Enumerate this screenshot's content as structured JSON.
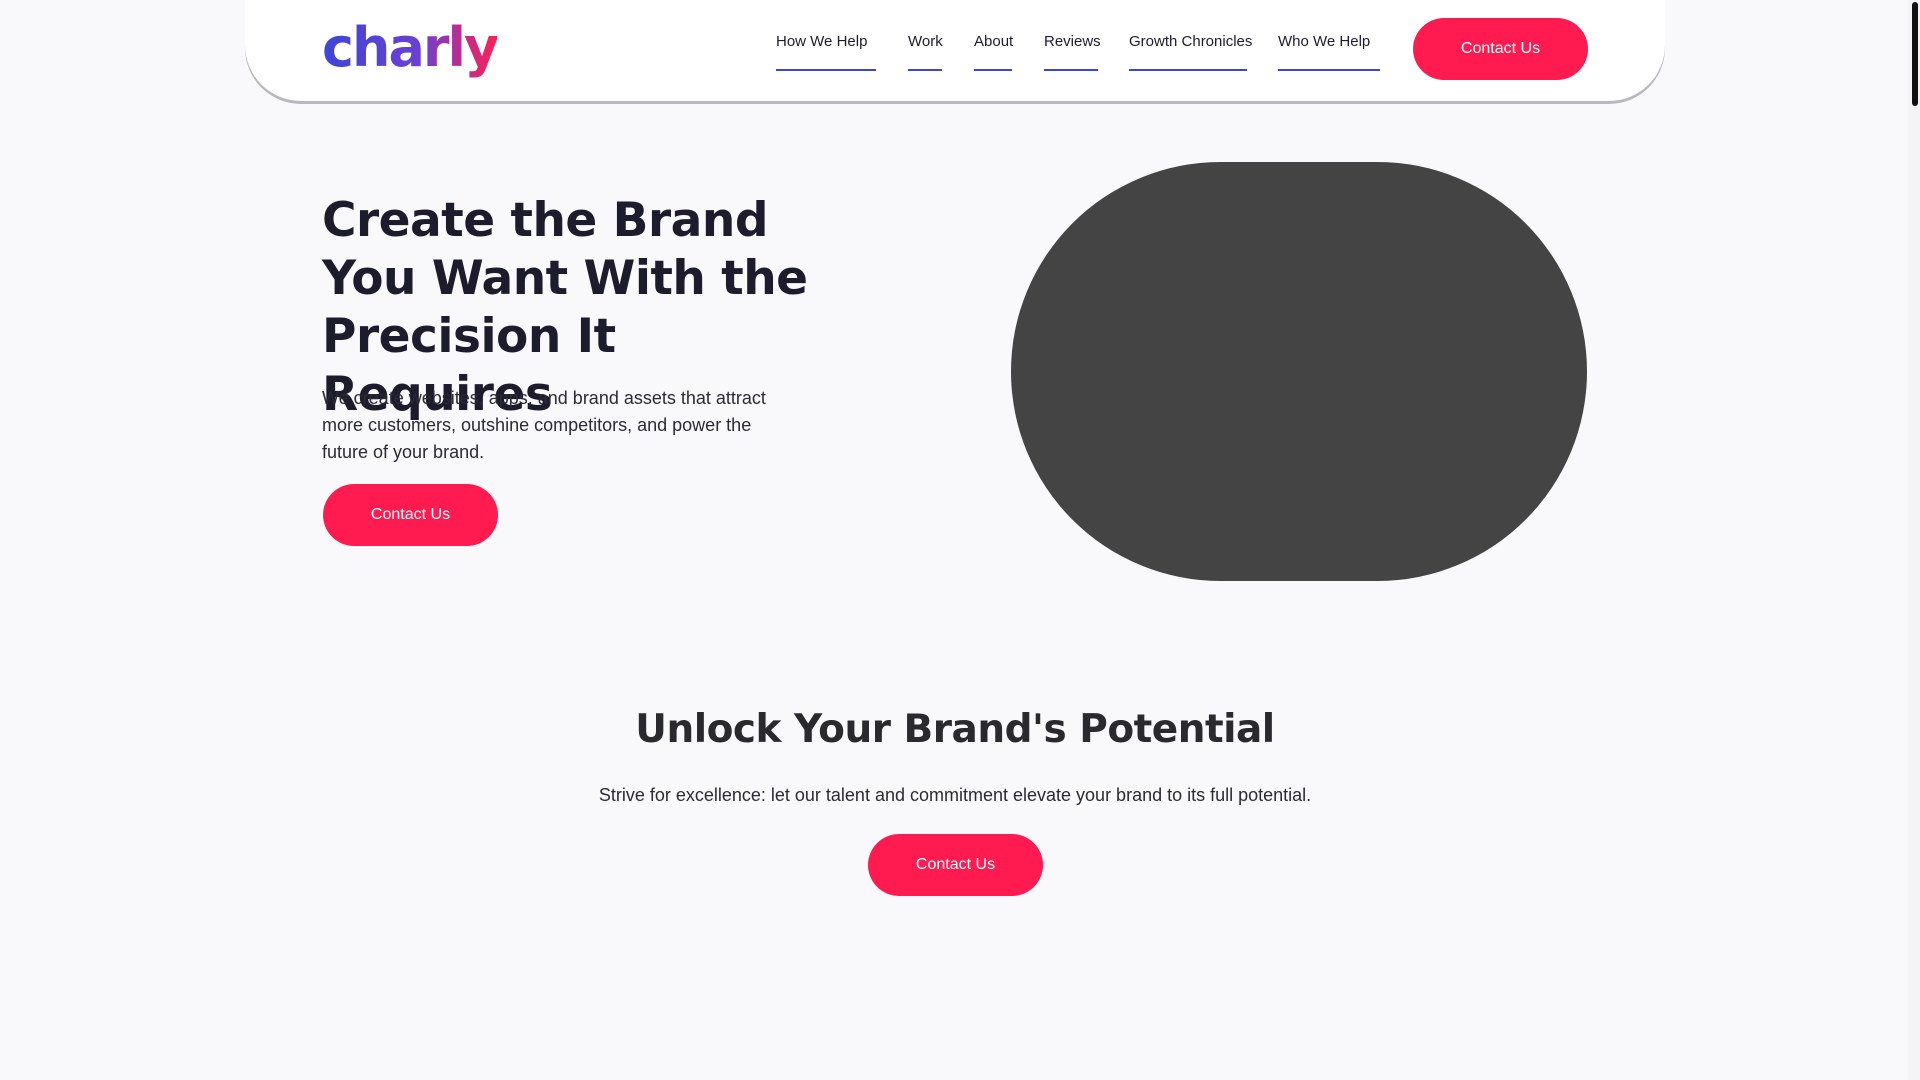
{
  "brand": {
    "logo_text": "charly"
  },
  "nav": {
    "items": [
      {
        "label": "How We Help"
      },
      {
        "label": "Work"
      },
      {
        "label": "About"
      },
      {
        "label": "Reviews"
      },
      {
        "label": "Growth Chronicles"
      },
      {
        "label": "Who We Help"
      }
    ],
    "cta_label": "Contact Us"
  },
  "hero": {
    "title": "Create the Brand You Want With the Precision It Requires",
    "subtitle": "We create websites, apps, and brand assets that attract more customers, outshine competitors, and power the future of your brand.",
    "cta_label": "Contact Us"
  },
  "unlock": {
    "title": "Unlock Your Brand's Potential",
    "subtitle": "Strive for excellence: let our talent and commitment elevate your brand to its full potential.",
    "cta_label": "Contact Us"
  },
  "colors": {
    "accent": "#ff1b4f",
    "brand_blue": "#3d46d8",
    "text": "#1d1c2c",
    "background": "#f9f9fc",
    "media_placeholder": "#444444"
  }
}
